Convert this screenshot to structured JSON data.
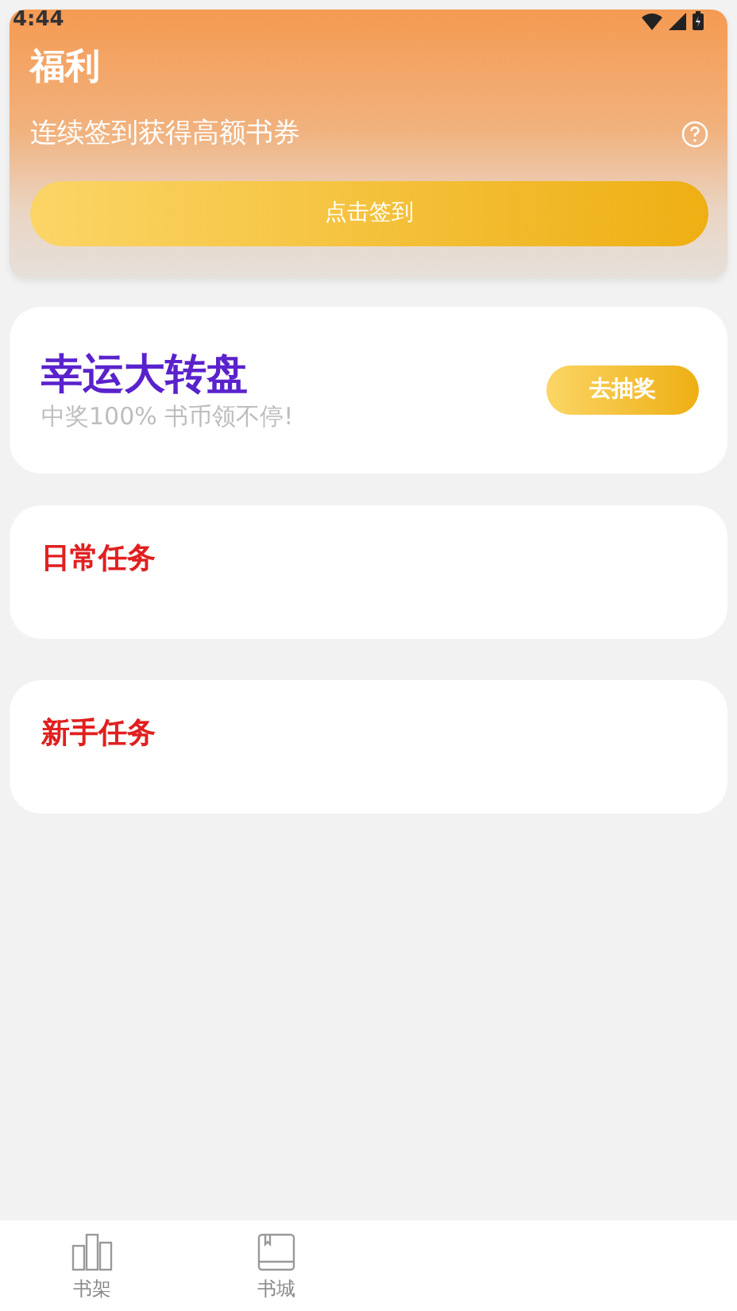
{
  "status_bar": {
    "time": "4:44"
  },
  "header": {
    "title": "福利",
    "subtitle": "连续签到获得高额书券",
    "button": "点击签到"
  },
  "lucky_wheel": {
    "title": "幸运大转盘",
    "subtitle": "中奖100% 书币领不停!",
    "button": "去抽奖"
  },
  "task_sections": [
    {
      "title": "日常任务"
    },
    {
      "title": "新手任务"
    }
  ],
  "bottom_nav": [
    {
      "label": "书架",
      "kind": "shelf"
    },
    {
      "label": "书城",
      "kind": "store"
    }
  ]
}
